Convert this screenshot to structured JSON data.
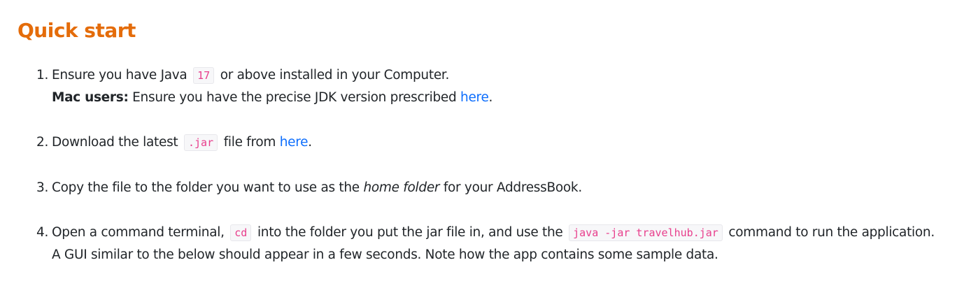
{
  "title": "Quick start",
  "steps": [
    {
      "num": "1.",
      "t1": "Ensure you have Java",
      "code1": "17",
      "t2": "or above installed in your Computer.",
      "sub_bold": "Mac users:",
      "sub_text": "Ensure you have the precise JDK version prescribed",
      "sub_link": "here",
      "sub_end": "."
    },
    {
      "num": "2.",
      "t1": "Download the latest",
      "code1": ".jar",
      "t2": "file from",
      "link": "here",
      "end": "."
    },
    {
      "num": "3.",
      "t1": "Copy the file to the folder you want to use as the",
      "em": "home folder",
      "t2": "for your AddressBook."
    },
    {
      "num": "4.",
      "t1": "Open a command terminal,",
      "code1": "cd",
      "t2": "into the folder you put the jar file in, and use the",
      "code2": "java -jar travelhub.jar",
      "t3": "command to run the application.",
      "sub_text": "A GUI similar to the below should appear in a few seconds. Note how the app contains some sample data."
    }
  ],
  "colors": {
    "title": "#e46c0a",
    "link": "#0d6efd",
    "code": "#e83e8c",
    "text": "#212529"
  }
}
